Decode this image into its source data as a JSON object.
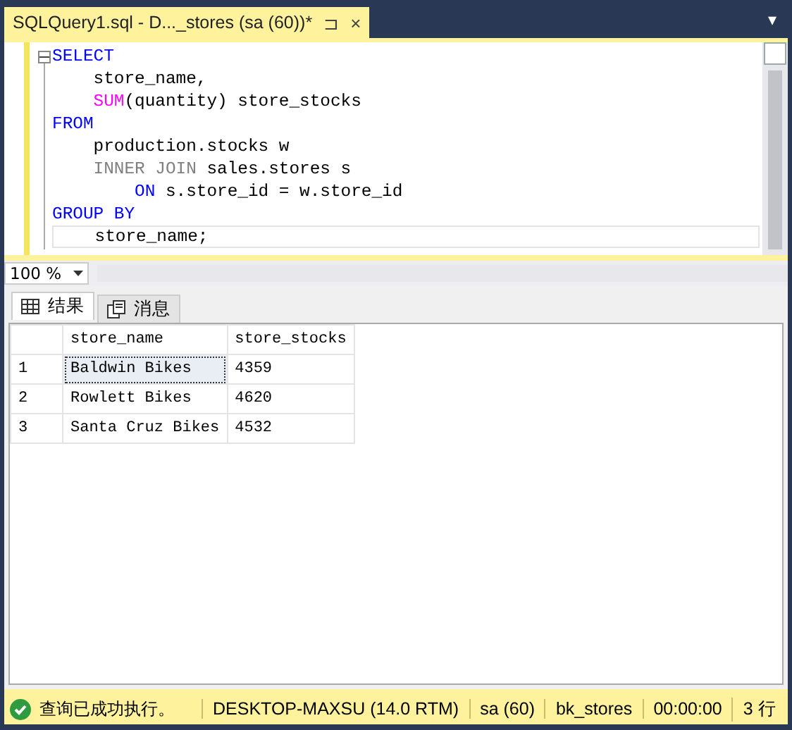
{
  "document_tab": {
    "title": "SQLQuery1.sql - D..._stores (sa (60))*",
    "pin": "⊐",
    "close": "×",
    "dropdown": "▾"
  },
  "editor": {
    "collapsed": false,
    "lines": [
      [
        {
          "kind": "keyword",
          "text": "SELECT"
        }
      ],
      [
        {
          "kind": "plain",
          "text": "    store_name,"
        }
      ],
      [
        {
          "kind": "function",
          "text": "    SUM"
        },
        {
          "kind": "plain",
          "text": "(quantity) store_stocks"
        }
      ],
      [
        {
          "kind": "keyword",
          "text": "FROM"
        }
      ],
      [
        {
          "kind": "plain",
          "text": "    production.stocks w"
        }
      ],
      [
        {
          "kind": "gray",
          "text": "    INNER JOIN"
        },
        {
          "kind": "plain",
          "text": " sales.stores s"
        }
      ],
      [
        {
          "kind": "keyword",
          "text": "        ON"
        },
        {
          "kind": "plain",
          "text": " s.store_id = w.store_id"
        }
      ],
      [
        {
          "kind": "keyword",
          "text": "GROUP BY"
        }
      ],
      [
        {
          "kind": "plain",
          "text": "    store_name;"
        }
      ]
    ]
  },
  "zoom": {
    "value": "100 %"
  },
  "result_tabs": [
    {
      "label": "结果",
      "selected": true
    },
    {
      "label": "消息",
      "selected": false
    }
  ],
  "table": {
    "columns": [
      "store_name",
      "store_stocks"
    ],
    "rows": [
      {
        "number": "1",
        "cells": [
          "Baldwin Bikes",
          "4359"
        ],
        "selected": true
      },
      {
        "number": "2",
        "cells": [
          "Rowlett Bikes",
          "4620"
        ],
        "selected": false
      },
      {
        "number": "3",
        "cells": [
          "Santa Cruz Bikes",
          "4532"
        ],
        "selected": false
      }
    ]
  },
  "status_bar": {
    "message": "查询已成功执行。",
    "server": "DESKTOP-MAXSU (14.0 RTM)",
    "user": "sa (60)",
    "database": "bk_stores",
    "elapsed": "00:00:00",
    "rows": "3 行"
  }
}
